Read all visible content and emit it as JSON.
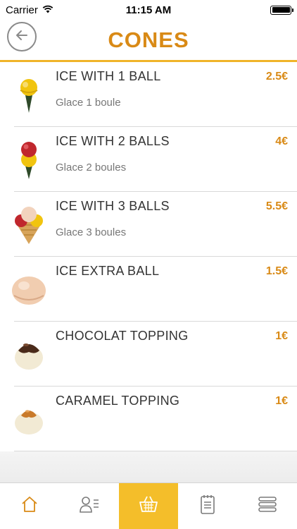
{
  "status_bar": {
    "carrier": "Carrier",
    "time": "11:15 AM",
    "battery_level": 1.0
  },
  "header": {
    "title": "CONES",
    "back_icon": "arrow-left-icon",
    "accent_color": "#d98a16",
    "line_color": "#f0b429"
  },
  "items": [
    {
      "name": "ICE WITH 1 BALL",
      "subtitle": "Glace 1 boule",
      "price": "2.5€",
      "icon": "cone-1-ball-icon"
    },
    {
      "name": "ICE WITH 2 BALLS",
      "subtitle": "Glace 2 boules",
      "price": "4€",
      "icon": "cone-2-balls-icon"
    },
    {
      "name": "ICE WITH 3 BALLS",
      "subtitle": "Glace 3 boules",
      "price": "5.5€",
      "icon": "cone-3-balls-icon"
    },
    {
      "name": "ICE EXTRA BALL",
      "subtitle": "",
      "price": "1.5€",
      "icon": "extra-ball-icon"
    },
    {
      "name": "CHOCOLAT TOPPING",
      "subtitle": "",
      "price": "1€",
      "icon": "chocolate-topping-icon"
    },
    {
      "name": "CARAMEL TOPPING",
      "subtitle": "",
      "price": "1€",
      "icon": "caramel-topping-icon"
    }
  ],
  "tab_bar": {
    "active_color": "#f4be2a",
    "tabs": [
      {
        "icon": "home-icon",
        "active": false
      },
      {
        "icon": "profile-list-icon",
        "active": false
      },
      {
        "icon": "basket-icon",
        "active": true
      },
      {
        "icon": "notepad-icon",
        "active": false
      },
      {
        "icon": "menu-icon",
        "active": false
      }
    ]
  }
}
